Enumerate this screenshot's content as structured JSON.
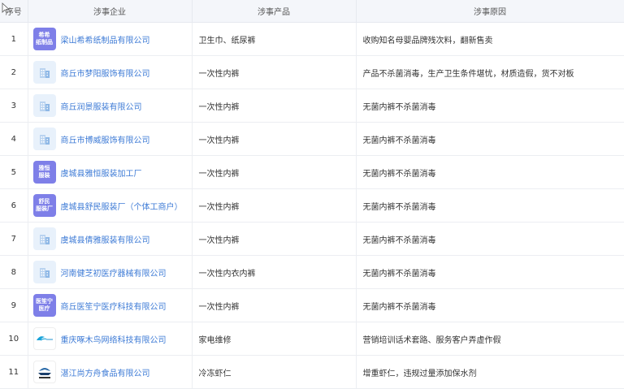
{
  "headers": {
    "index": "序号",
    "enterprise": "涉事企业",
    "product": "涉事产品",
    "reason": "涉事原因"
  },
  "rows": [
    {
      "index": "1",
      "logo_type": "text",
      "logo_text": "希希\n纸制品",
      "logo_color": "#7e7fe8",
      "enterprise": "梁山希希纸制品有限公司",
      "product": "卫生巾、纸尿裤",
      "reason": "收购知名母婴品牌残次料，翻新售卖"
    },
    {
      "index": "2",
      "logo_type": "building-icon",
      "logo_text": "",
      "enterprise": "商丘市梦阳服饰有限公司",
      "product": "一次性内裤",
      "reason": "产品不杀菌消毒，生产卫生条件堪忧，材质造假，货不对板"
    },
    {
      "index": "3",
      "logo_type": "building-icon",
      "logo_text": "",
      "enterprise": "商丘润景服装有限公司",
      "product": "一次性内裤",
      "reason": "无菌内裤不杀菌消毒"
    },
    {
      "index": "4",
      "logo_type": "building-icon",
      "logo_text": "",
      "enterprise": "商丘市博威服饰有限公司",
      "product": "一次性内裤",
      "reason": "无菌内裤不杀菌消毒"
    },
    {
      "index": "5",
      "logo_type": "text",
      "logo_text": "雅恒\n服装",
      "logo_color": "#7e7fe8",
      "enterprise": "虞城县雅恒服装加工厂",
      "product": "一次性内裤",
      "reason": "无菌内裤不杀菌消毒"
    },
    {
      "index": "6",
      "logo_type": "text",
      "logo_text": "舒民\n服装厂",
      "logo_color": "#7e7fe8",
      "enterprise": "虞城县舒民服装厂（个体工商户）",
      "product": "一次性内裤",
      "reason": "无菌内裤不杀菌消毒"
    },
    {
      "index": "7",
      "logo_type": "building-icon",
      "logo_text": "",
      "enterprise": "虞城县倩雅服装有限公司",
      "product": "一次性内裤",
      "reason": "无菌内裤不杀菌消毒"
    },
    {
      "index": "8",
      "logo_type": "building-icon",
      "logo_text": "",
      "enterprise": "河南健芝初医疗器械有限公司",
      "product": "一次性内衣内裤",
      "reason": "无菌内裤不杀菌消毒"
    },
    {
      "index": "9",
      "logo_type": "text",
      "logo_text": "医笙宁\n医疗",
      "logo_color": "#7e7fe8",
      "enterprise": "商丘医笙宁医疗科技有限公司",
      "product": "一次性内裤",
      "reason": "无菌内裤不杀菌消毒"
    },
    {
      "index": "10",
      "logo_type": "bird-logo",
      "logo_text": "",
      "enterprise": "重庆啄木鸟网络科技有限公司",
      "product": "家电维修",
      "reason": "营销培训话术套路、服务客户弄虚作假"
    },
    {
      "index": "11",
      "logo_type": "boat-logo",
      "logo_text": "",
      "enterprise": "湛江尚方舟食品有限公司",
      "product": "冷冻虾仁",
      "reason": "增重虾仁，违规过量添加保水剂"
    }
  ]
}
